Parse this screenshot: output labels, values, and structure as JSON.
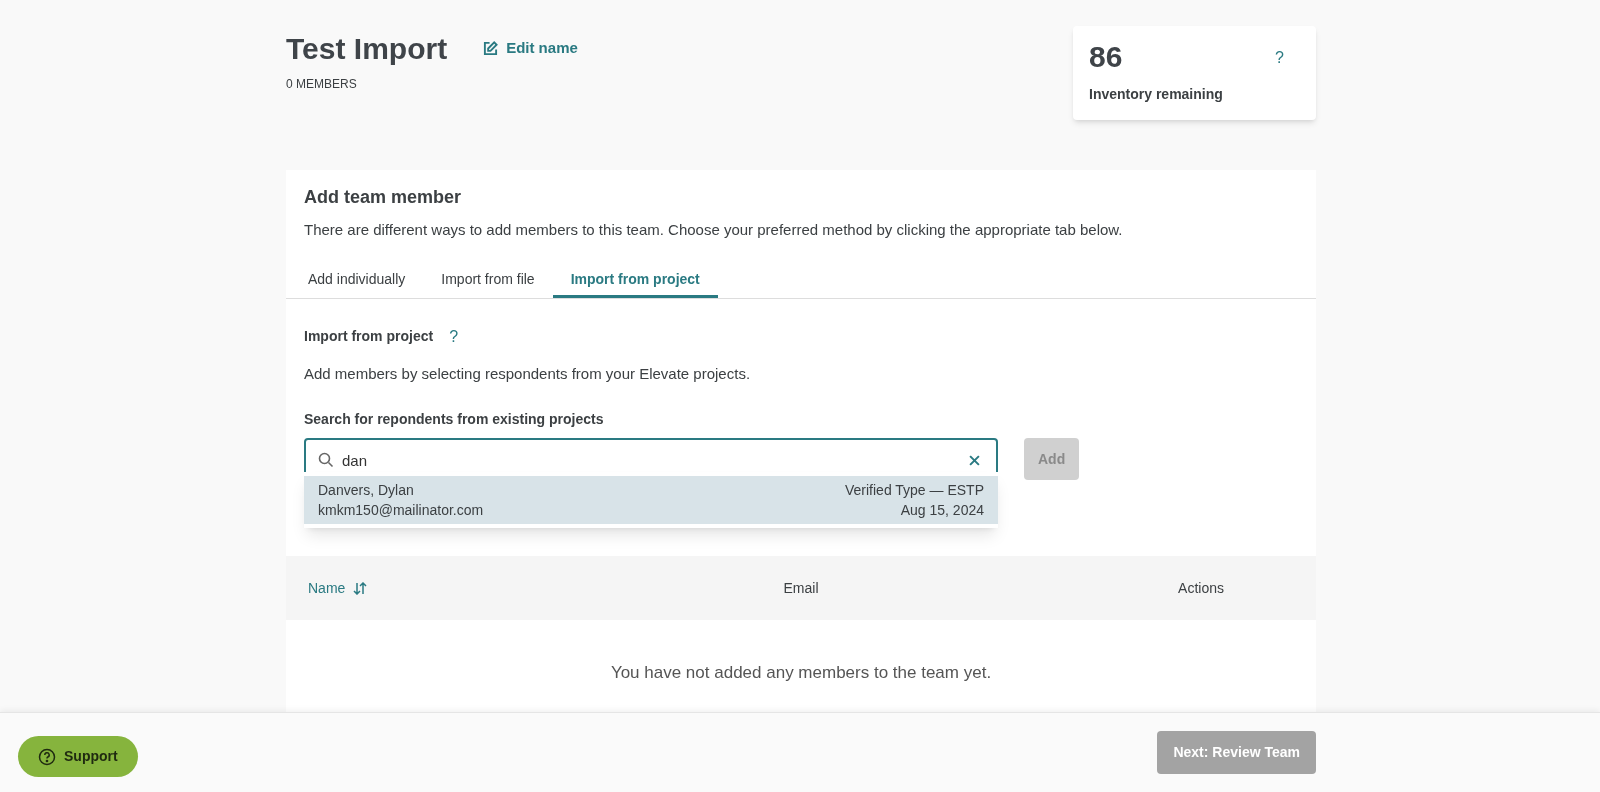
{
  "header": {
    "title": "Test Import",
    "edit_link": "Edit name",
    "members": "0 MEMBERS"
  },
  "inventory": {
    "count": "86",
    "label": "Inventory remaining",
    "help": "?"
  },
  "add_member": {
    "title": "Add team member",
    "description": "There are different ways to add members to this team. Choose your preferred method by clicking the appropriate tab below.",
    "tabs": [
      {
        "label": "Add individually",
        "selected": false
      },
      {
        "label": "Import from file",
        "selected": false
      },
      {
        "label": "Import from project",
        "selected": true
      }
    ],
    "section_title": "Import from project",
    "section_help": "?",
    "section_description": "Add members by selecting respondents from your Elevate projects.",
    "search": {
      "label": "Search for repondents from existing projects",
      "value": "dan"
    },
    "add_button": {
      "label": "Add",
      "disabled": true
    },
    "suggestions": [
      {
        "name": "Danvers, Dylan",
        "email": "kmkm150@mailinator.com",
        "type": "Verified Type — ESTP",
        "date": "Aug 15, 2024",
        "selected": true
      }
    ]
  },
  "team_list": {
    "columns": [
      "Name",
      "Email",
      "Actions"
    ],
    "empty_message": "You have not added any members to the team yet."
  },
  "footer": {
    "support": "Support",
    "next": {
      "label": "Next: Review Team",
      "disabled": true
    }
  }
}
